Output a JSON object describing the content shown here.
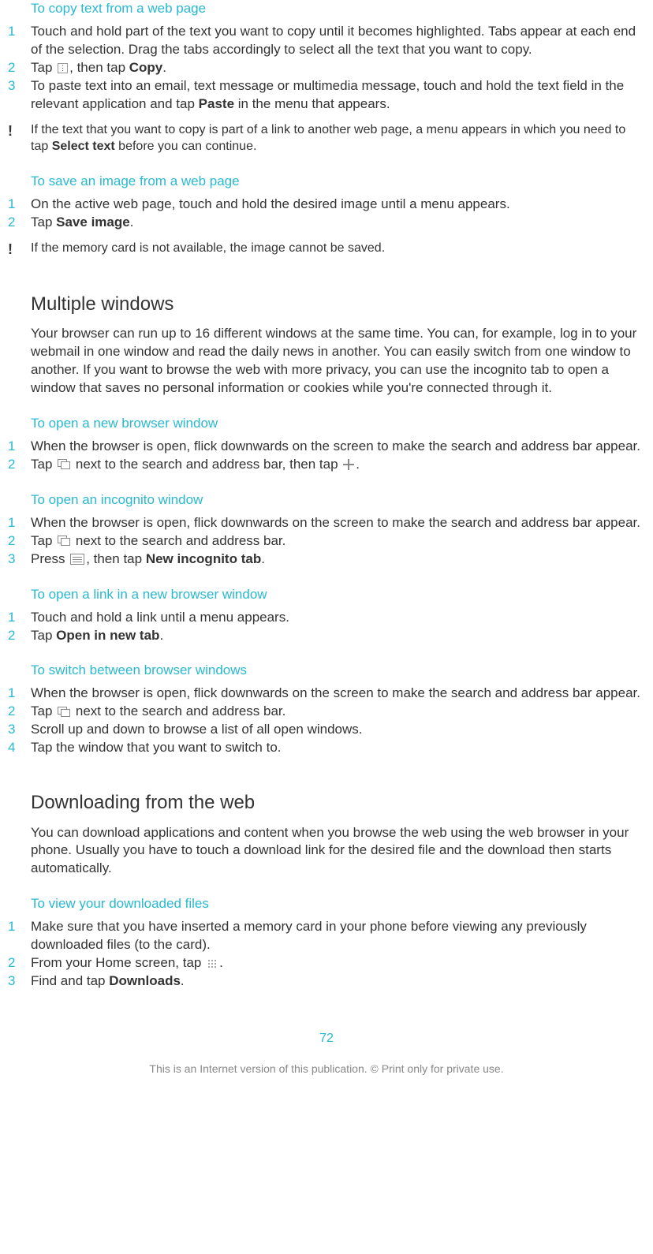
{
  "section_copy": {
    "heading": "To copy text from a web page",
    "steps": [
      {
        "num": "1",
        "text": "Touch and hold part of the text you want to copy until it becomes highlighted. Tabs appear at each end of the selection. Drag the tabs accordingly to select all the text that you want to copy."
      },
      {
        "num": "2",
        "a": "Tap ",
        "b": ", then tap ",
        "bold": "Copy",
        "c": "."
      },
      {
        "num": "3",
        "a": "To paste text into an email, text message or multimedia message, touch and hold the text field in the relevant application and tap ",
        "bold": "Paste",
        "b": " in the menu that appears."
      }
    ],
    "note": {
      "a": "If the text that you want to copy is part of a link to another web page, a menu appears in which you need to tap ",
      "bold": "Select text",
      "b": " before you can continue."
    }
  },
  "section_save": {
    "heading": "To save an image from a web page",
    "steps": [
      {
        "num": "1",
        "text": "On the active web page, touch and hold the desired image until a menu appears."
      },
      {
        "num": "2",
        "a": "Tap ",
        "bold": "Save image",
        "b": "."
      }
    ],
    "note": "If the memory card is not available, the image cannot be saved."
  },
  "section_multiple": {
    "heading": "Multiple windows",
    "intro": "Your browser can run up to 16 different windows at the same time. You can, for example, log in to your webmail in one window and read the daily news in another. You can easily switch from one window to another. If you want to browse the web with more privacy, you can use the incognito tab to open a window that saves no personal information or cookies while you're connected through it."
  },
  "section_open_window": {
    "heading": "To open a new browser window",
    "steps": [
      {
        "num": "1",
        "text": "When the browser is open, flick downwards on the screen to make the search and address bar appear."
      },
      {
        "num": "2",
        "a": "Tap ",
        "b": " next to the search and address bar, then tap ",
        "c": "."
      }
    ]
  },
  "section_incognito": {
    "heading": "To open an incognito window",
    "steps": [
      {
        "num": "1",
        "text": "When the browser is open, flick downwards on the screen to make the search and address bar appear."
      },
      {
        "num": "2",
        "a": "Tap ",
        "b": " next to the search and address bar."
      },
      {
        "num": "3",
        "a": "Press ",
        "b": ", then tap ",
        "bold": "New incognito tab",
        "c": "."
      }
    ]
  },
  "section_link_window": {
    "heading": "To open a link in a new browser window",
    "steps": [
      {
        "num": "1",
        "text": "Touch and hold a link until a menu appears."
      },
      {
        "num": "2",
        "a": "Tap ",
        "bold": "Open in new tab",
        "b": "."
      }
    ]
  },
  "section_switch": {
    "heading": "To switch between browser windows",
    "steps": [
      {
        "num": "1",
        "text": "When the browser is open, flick downwards on the screen to make the search and address bar appear."
      },
      {
        "num": "2",
        "a": "Tap ",
        "b": " next to the search and address bar."
      },
      {
        "num": "3",
        "text": "Scroll up and down to browse a list of all open windows."
      },
      {
        "num": "4",
        "text": "Tap the window that you want to switch to."
      }
    ]
  },
  "section_download": {
    "heading": "Downloading from the web",
    "intro": "You can download applications and content when you browse the web using the web browser in your phone. Usually you have to touch a download link for the desired file and the download then starts automatically."
  },
  "section_view_download": {
    "heading": "To view your downloaded files",
    "steps": [
      {
        "num": "1",
        "text": "Make sure that you have inserted a memory card in your phone before viewing any previously downloaded files (to the card)."
      },
      {
        "num": "2",
        "a": "From your Home screen, tap ",
        "b": "."
      },
      {
        "num": "3",
        "a": "Find and tap ",
        "bold": "Downloads",
        "b": "."
      }
    ]
  },
  "page_number": "72",
  "footer": "This is an Internet version of this publication. © Print only for private use."
}
